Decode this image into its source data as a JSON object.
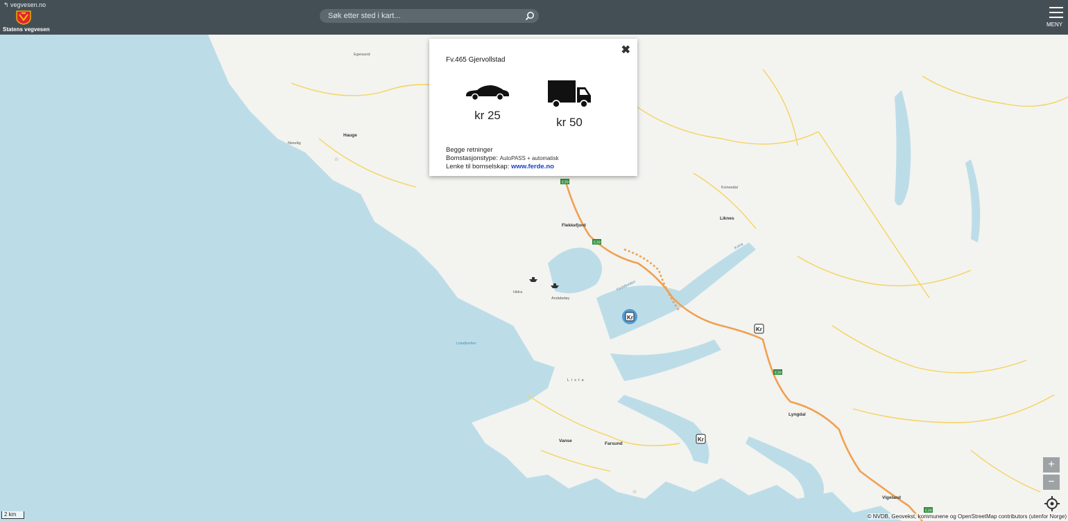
{
  "header": {
    "back_link": "vegvesen.no",
    "brand": "Statens vegvesen",
    "search_placeholder": "Søk etter sted i kart...",
    "menu_label": "MENY"
  },
  "popup": {
    "title": "Fv.465 Gjervollstad",
    "car_price": "kr 25",
    "truck_price": "kr 50",
    "direction": "Begge retninger",
    "station_type_label": "Bomstasjonstype:",
    "station_type_value": "AutoPASS + automatisk",
    "link_label": "Lenke til bomselskap:",
    "link_text": "www.ferde.no"
  },
  "map": {
    "places": [
      "Hauge",
      "Flekkefjord",
      "Liknes",
      "Kvinesdal",
      "Lyngdal",
      "Vanse",
      "Farsund",
      "Vigeland",
      "Lista",
      "Listafjorden",
      "Fedafjorden",
      "Hidra",
      "Andabeløy",
      "Kvina",
      "Nesvåg",
      "Egersund"
    ],
    "road_shields": [
      "E39",
      "E39",
      "E39",
      "E39"
    ],
    "toll_marker": "Kr"
  },
  "controls": {
    "zoom_in": "+",
    "zoom_out": "−",
    "scale": "2 km",
    "attribution": "© NVDB, Geovekst, kommunene og OpenStreetMap contributors (utenfor Norge)"
  },
  "colors": {
    "header": "#444f55",
    "water": "#bcdde8",
    "land": "#f3f3f0",
    "road_major": "#f0a050",
    "road_minor": "#f5d35a",
    "link": "#1a3fc7",
    "toll_highlight": "#3b8fd0"
  }
}
